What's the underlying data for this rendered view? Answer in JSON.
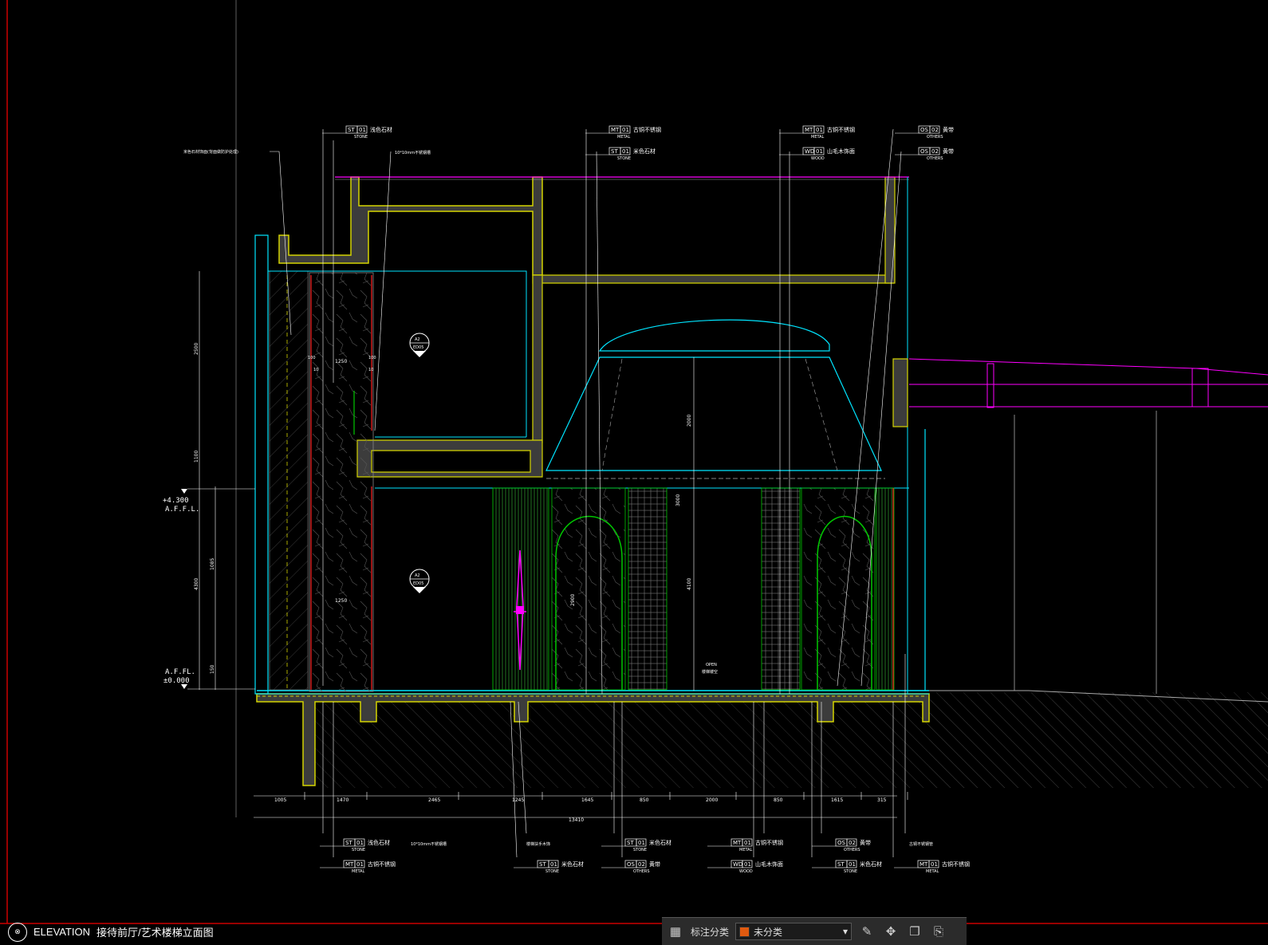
{
  "drawing": {
    "view_label": "ELEVATION",
    "view_title": "接待前厅/艺术楼梯立面图",
    "view_icon": "section-marker-icon"
  },
  "levels": {
    "upper": "+4.300",
    "upper_sub": "A.F.F.L.",
    "lower": "A.F.FL.",
    "lower_sub": "±0.000"
  },
  "top_tags": [
    {
      "code": "ST",
      "num": "01",
      "text": "浅色石材",
      "sub": "STONE"
    },
    {
      "code": "MT",
      "num": "01",
      "text": "古铜不锈钢",
      "sub": "METAL"
    },
    {
      "code": "ST",
      "num": "01",
      "text": "米色石材",
      "sub": "STONE"
    },
    {
      "code": "MT",
      "num": "01",
      "text": "古铜不锈钢",
      "sub": "METAL"
    },
    {
      "code": "WD",
      "num": "01",
      "text": "山毛木饰面",
      "sub": "WOOD"
    },
    {
      "code": "OS",
      "num": "02",
      "text": "黄带",
      "sub": "OTHERS"
    },
    {
      "code": "OS",
      "num": "02",
      "text": "黄带",
      "sub": "OTHERS"
    }
  ],
  "bottom_tags": [
    {
      "code": "ST",
      "num": "01",
      "text": "浅色石材",
      "sub": "STONE"
    },
    {
      "code": "MT",
      "num": "01",
      "text": "古铜不锈钢",
      "sub": "METAL"
    },
    {
      "code": "ST",
      "num": "01",
      "text": "米色石材",
      "sub": "STONE"
    },
    {
      "code": "ST",
      "num": "01",
      "text": "米色石材",
      "sub": "STONE"
    },
    {
      "code": "OS",
      "num": "02",
      "text": "黄带",
      "sub": "OTHERS"
    },
    {
      "code": "MT",
      "num": "01",
      "text": "古铜不锈钢",
      "sub": "METAL"
    },
    {
      "code": "WD",
      "num": "01",
      "text": "山毛木饰面",
      "sub": "WOOD"
    },
    {
      "code": "OS",
      "num": "02",
      "text": "黄带",
      "sub": "OTHERS"
    },
    {
      "code": "ST",
      "num": "01",
      "text": "米色石材",
      "sub": "STONE"
    },
    {
      "code": "MT",
      "num": "01",
      "text": "古铜不锈钢",
      "sub": "METAL"
    }
  ],
  "notes": {
    "gap_top": "10*10mm不锈钢槽",
    "gap_bottom": "10*10mm不锈钢槽",
    "wall_note": "米色石材饰面(背面做防护处理)",
    "open_label": "OPEN",
    "open_sub": "楼梯镂空",
    "handrail": "楼梯扶手木饰",
    "brass_pipe": "古铜不锈钢管"
  },
  "section_callouts": [
    {
      "num": "A2",
      "ref": "ED05"
    },
    {
      "num": "A2",
      "ref": "ED05"
    }
  ],
  "dimensions": {
    "bottom_chain": [
      "1005",
      "1470",
      "2465",
      "1245",
      "1645",
      "850",
      "2000",
      "850",
      "1615",
      "315"
    ],
    "bottom_total": "13410",
    "left_chain": [
      "2500",
      "1100",
      "4300",
      "1085",
      "150"
    ],
    "inner_w": [
      "1250",
      "1250"
    ],
    "inner_small": [
      "100",
      "100",
      "10",
      "10"
    ],
    "vert_center": [
      "2000",
      "3000",
      "4100",
      "2900"
    ]
  },
  "toolbar": {
    "annotate_label": "标注分类",
    "category_value": "未分类",
    "category_color": "#e05a10",
    "grid_icon": "grid-icon",
    "edit_icon": "edit-icon",
    "move_icon": "move-icon",
    "copy_icon": "copy-icon",
    "paste_icon": "paste-icon"
  },
  "colors": {
    "wall": "#d4d400",
    "glass": "#00e5ff",
    "finish": "#00c800",
    "red": "#ff2020",
    "magenta": "#ff00ff",
    "frame": "#cc0000"
  }
}
